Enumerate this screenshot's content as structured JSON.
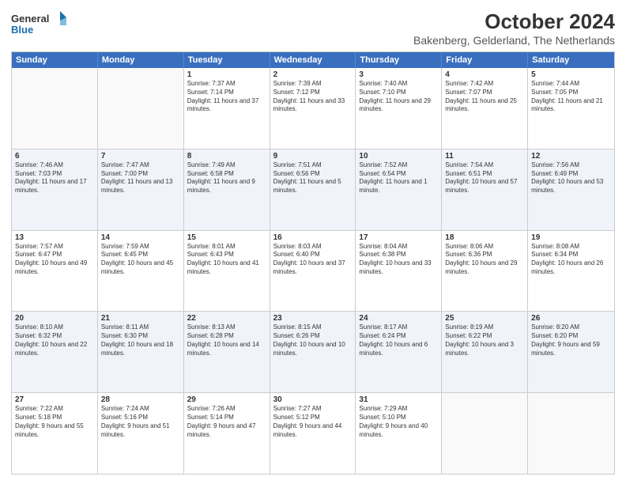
{
  "logo": {
    "line1": "General",
    "line2": "Blue"
  },
  "title": "October 2024",
  "subtitle": "Bakenberg, Gelderland, The Netherlands",
  "days": [
    "Sunday",
    "Monday",
    "Tuesday",
    "Wednesday",
    "Thursday",
    "Friday",
    "Saturday"
  ],
  "weeks": [
    [
      {
        "day": "",
        "info": ""
      },
      {
        "day": "",
        "info": ""
      },
      {
        "day": "1",
        "info": "Sunrise: 7:37 AM\nSunset: 7:14 PM\nDaylight: 11 hours and 37 minutes."
      },
      {
        "day": "2",
        "info": "Sunrise: 7:39 AM\nSunset: 7:12 PM\nDaylight: 11 hours and 33 minutes."
      },
      {
        "day": "3",
        "info": "Sunrise: 7:40 AM\nSunset: 7:10 PM\nDaylight: 11 hours and 29 minutes."
      },
      {
        "day": "4",
        "info": "Sunrise: 7:42 AM\nSunset: 7:07 PM\nDaylight: 11 hours and 25 minutes."
      },
      {
        "day": "5",
        "info": "Sunrise: 7:44 AM\nSunset: 7:05 PM\nDaylight: 11 hours and 21 minutes."
      }
    ],
    [
      {
        "day": "6",
        "info": "Sunrise: 7:46 AM\nSunset: 7:03 PM\nDaylight: 11 hours and 17 minutes."
      },
      {
        "day": "7",
        "info": "Sunrise: 7:47 AM\nSunset: 7:00 PM\nDaylight: 11 hours and 13 minutes."
      },
      {
        "day": "8",
        "info": "Sunrise: 7:49 AM\nSunset: 6:58 PM\nDaylight: 11 hours and 9 minutes."
      },
      {
        "day": "9",
        "info": "Sunrise: 7:51 AM\nSunset: 6:56 PM\nDaylight: 11 hours and 5 minutes."
      },
      {
        "day": "10",
        "info": "Sunrise: 7:52 AM\nSunset: 6:54 PM\nDaylight: 11 hours and 1 minute."
      },
      {
        "day": "11",
        "info": "Sunrise: 7:54 AM\nSunset: 6:51 PM\nDaylight: 10 hours and 57 minutes."
      },
      {
        "day": "12",
        "info": "Sunrise: 7:56 AM\nSunset: 6:49 PM\nDaylight: 10 hours and 53 minutes."
      }
    ],
    [
      {
        "day": "13",
        "info": "Sunrise: 7:57 AM\nSunset: 6:47 PM\nDaylight: 10 hours and 49 minutes."
      },
      {
        "day": "14",
        "info": "Sunrise: 7:59 AM\nSunset: 6:45 PM\nDaylight: 10 hours and 45 minutes."
      },
      {
        "day": "15",
        "info": "Sunrise: 8:01 AM\nSunset: 6:43 PM\nDaylight: 10 hours and 41 minutes."
      },
      {
        "day": "16",
        "info": "Sunrise: 8:03 AM\nSunset: 6:40 PM\nDaylight: 10 hours and 37 minutes."
      },
      {
        "day": "17",
        "info": "Sunrise: 8:04 AM\nSunset: 6:38 PM\nDaylight: 10 hours and 33 minutes."
      },
      {
        "day": "18",
        "info": "Sunrise: 8:06 AM\nSunset: 6:36 PM\nDaylight: 10 hours and 29 minutes."
      },
      {
        "day": "19",
        "info": "Sunrise: 8:08 AM\nSunset: 6:34 PM\nDaylight: 10 hours and 26 minutes."
      }
    ],
    [
      {
        "day": "20",
        "info": "Sunrise: 8:10 AM\nSunset: 6:32 PM\nDaylight: 10 hours and 22 minutes."
      },
      {
        "day": "21",
        "info": "Sunrise: 8:11 AM\nSunset: 6:30 PM\nDaylight: 10 hours and 18 minutes."
      },
      {
        "day": "22",
        "info": "Sunrise: 8:13 AM\nSunset: 6:28 PM\nDaylight: 10 hours and 14 minutes."
      },
      {
        "day": "23",
        "info": "Sunrise: 8:15 AM\nSunset: 6:26 PM\nDaylight: 10 hours and 10 minutes."
      },
      {
        "day": "24",
        "info": "Sunrise: 8:17 AM\nSunset: 6:24 PM\nDaylight: 10 hours and 6 minutes."
      },
      {
        "day": "25",
        "info": "Sunrise: 8:19 AM\nSunset: 6:22 PM\nDaylight: 10 hours and 3 minutes."
      },
      {
        "day": "26",
        "info": "Sunrise: 8:20 AM\nSunset: 6:20 PM\nDaylight: 9 hours and 59 minutes."
      }
    ],
    [
      {
        "day": "27",
        "info": "Sunrise: 7:22 AM\nSunset: 5:18 PM\nDaylight: 9 hours and 55 minutes."
      },
      {
        "day": "28",
        "info": "Sunrise: 7:24 AM\nSunset: 5:16 PM\nDaylight: 9 hours and 51 minutes."
      },
      {
        "day": "29",
        "info": "Sunrise: 7:26 AM\nSunset: 5:14 PM\nDaylight: 9 hours and 47 minutes."
      },
      {
        "day": "30",
        "info": "Sunrise: 7:27 AM\nSunset: 5:12 PM\nDaylight: 9 hours and 44 minutes."
      },
      {
        "day": "31",
        "info": "Sunrise: 7:29 AM\nSunset: 5:10 PM\nDaylight: 9 hours and 40 minutes."
      },
      {
        "day": "",
        "info": ""
      },
      {
        "day": "",
        "info": ""
      }
    ]
  ]
}
